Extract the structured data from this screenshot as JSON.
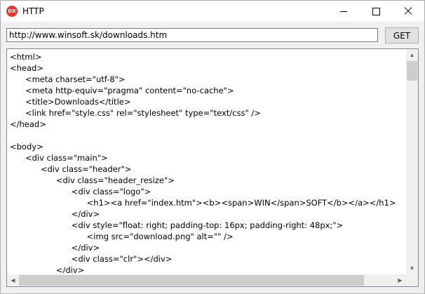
{
  "window": {
    "title": "HTTP",
    "icon_text": "DX",
    "icons": {
      "app": "devexpress-logo-icon",
      "minimize": "minimize-icon",
      "maximize": "maximize-icon",
      "close": "close-icon"
    }
  },
  "toolbar": {
    "url": "http://www.winsoft.sk/downloads.htm",
    "get_label": "GET"
  },
  "response": {
    "lines": [
      "<html>",
      "<head>",
      "\t<meta charset=\"utf-8\">",
      "\t<meta http-equiv=\"pragma\" content=\"no-cache\">",
      "\t<title>Downloads</title>",
      "\t<link href=\"style.css\" rel=\"stylesheet\" type=\"text/css\" />",
      "</head>",
      "",
      "<body>",
      "\t<div class=\"main\">",
      "\t\t<div class=\"header\">",
      "\t\t\t<div class=\"header_resize\">",
      "\t\t\t\t<div class=\"logo\">",
      "\t\t\t\t\t<h1><a href=\"index.htm\"><b><span>WIN</span>SOFT</b></a></h1>",
      "\t\t\t\t</div>",
      "\t\t\t\t<div style=\"float: right; padding-top: 16px; padding-right: 48px;\">",
      "\t\t\t\t\t<img src=\"download.png\" alt=\"\" />",
      "\t\t\t\t</div>",
      "\t\t\t\t<div class=\"clr\"></div>",
      "\t\t\t</div>"
    ]
  },
  "scrollbars": {
    "vertical_position": 0,
    "horizontal_position": 0
  }
}
